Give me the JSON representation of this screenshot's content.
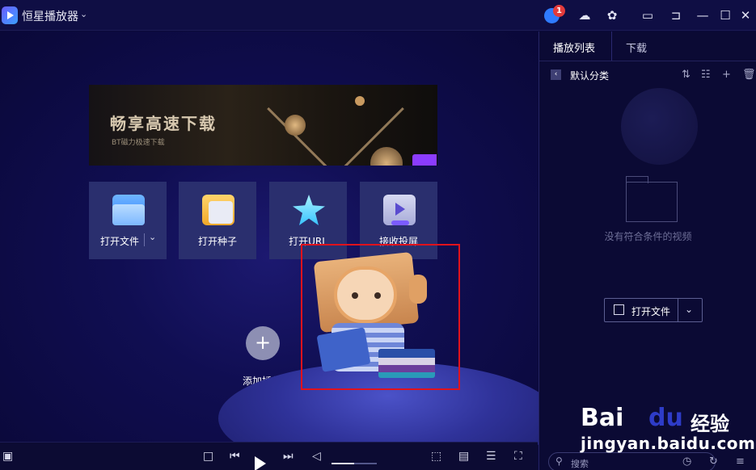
{
  "app": {
    "title": "恒星播放器"
  },
  "titlebar": {
    "notification_count": "1"
  },
  "banner": {
    "title": "畅享高速下载",
    "subtitle": "BT磁力极速下载"
  },
  "actions": [
    {
      "label": "打开文件"
    },
    {
      "label": "打开种子"
    },
    {
      "label": "打开URL"
    },
    {
      "label": "接收投屏"
    }
  ],
  "plugin": {
    "label": "添加插件",
    "plus": "+"
  },
  "sidebar": {
    "tabs": [
      {
        "label": "播放列表"
      },
      {
        "label": "下载"
      }
    ],
    "category": "默认分类",
    "empty_text": "没有符合条件的视频",
    "open_file_label": "打开文件",
    "search_placeholder": "搜索"
  },
  "watermark": {
    "brand_bai": "Bai",
    "brand_du": "du",
    "brand_cn": "经验",
    "url": "jingyan.baidu.com"
  },
  "colors": {
    "background": "#0b0a3a",
    "tile": "#2a2f6e",
    "highlight": "#e0121c",
    "badge": "#e33b3b"
  }
}
